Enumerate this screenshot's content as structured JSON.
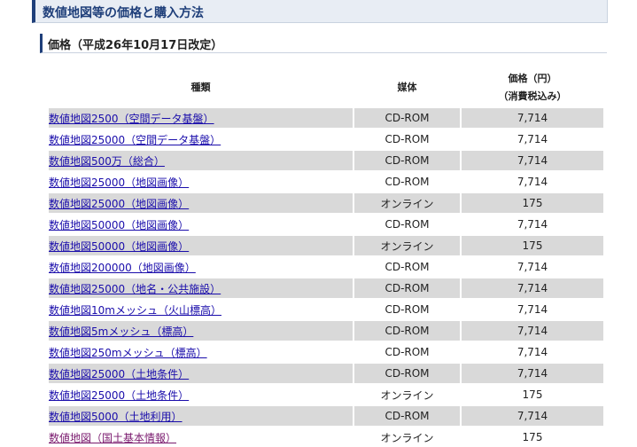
{
  "header": {
    "title": "数値地図等の価格と購入方法"
  },
  "section": {
    "heading": "価格（平成26年10月17日改定）"
  },
  "table": {
    "columns": {
      "name": "種類",
      "media": "媒体",
      "price_line1": "価格（円）",
      "price_line2": "（消費税込み）"
    },
    "rows": [
      {
        "name": "数値地図2500（空間データ基盤）",
        "media": "CD-ROM",
        "price": "7,714"
      },
      {
        "name": "数値地図25000（空間データ基盤）",
        "media": "CD-ROM",
        "price": "7,714"
      },
      {
        "name": "数値地図500万（総合）",
        "media": "CD-ROM",
        "price": "7,714"
      },
      {
        "name": "数値地図25000（地図画像）",
        "media": "CD-ROM",
        "price": "7,714"
      },
      {
        "name": "数値地図25000（地図画像）",
        "media": "オンライン",
        "price": "175"
      },
      {
        "name": "数値地図50000（地図画像）",
        "media": "CD-ROM",
        "price": "7,714"
      },
      {
        "name": "数値地図50000（地図画像）",
        "media": "オンライン",
        "price": "175"
      },
      {
        "name": "数値地図200000（地図画像）",
        "media": "CD-ROM",
        "price": "7,714"
      },
      {
        "name": "数値地図25000（地名・公共施設）",
        "media": "CD-ROM",
        "price": "7,714"
      },
      {
        "name": "数値地図10mメッシュ（火山標高）",
        "media": "CD-ROM",
        "price": "7,714"
      },
      {
        "name": "数値地図5mメッシュ（標高）",
        "media": "CD-ROM",
        "price": "7,714"
      },
      {
        "name": "数値地図250mメッシュ（標高）",
        "media": "CD-ROM",
        "price": "7,714"
      },
      {
        "name": "数値地図25000（土地条件）",
        "media": "CD-ROM",
        "price": "7,714"
      },
      {
        "name": "数値地図25000（土地条件）",
        "media": "オンライン",
        "price": "175"
      },
      {
        "name": "数値地図5000（土地利用）",
        "media": "CD-ROM",
        "price": "7,714"
      },
      {
        "name": "数値地図（国土基本情報）",
        "media": "オンライン",
        "price": "175"
      }
    ]
  }
}
